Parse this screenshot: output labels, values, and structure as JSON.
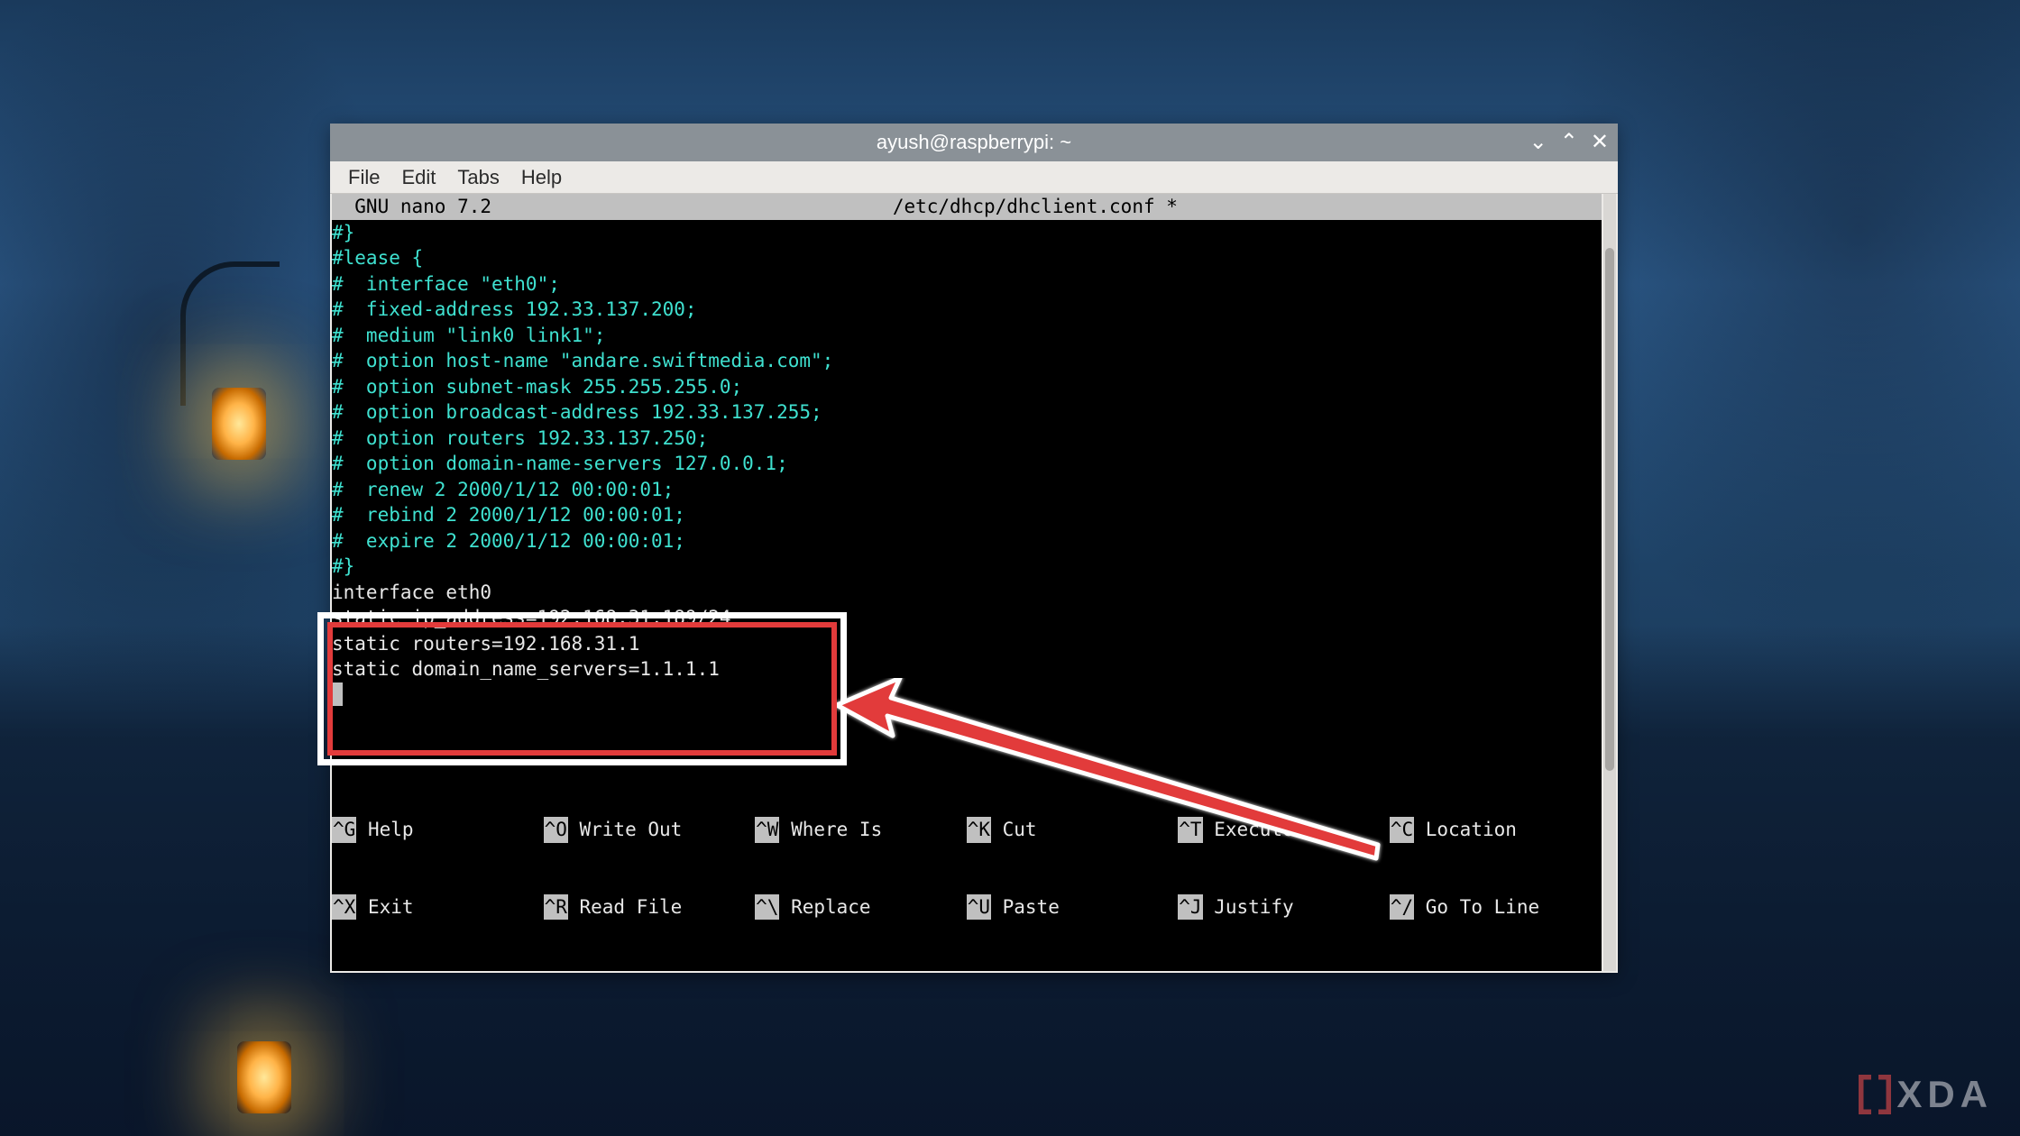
{
  "titlebar": {
    "title": "ayush@raspberrypi: ~"
  },
  "menubar": {
    "file": "File",
    "edit": "Edit",
    "tabs": "Tabs",
    "help": "Help"
  },
  "nano": {
    "app": "GNU nano 7.2",
    "filepath": "/etc/dhcp/dhclient.conf *"
  },
  "editor": {
    "lines_cyan": [
      "#}",
      "",
      "#lease {",
      "#  interface \"eth0\";",
      "#  fixed-address 192.33.137.200;",
      "#  medium \"link0 link1\";",
      "#  option host-name \"andare.swiftmedia.com\";",
      "#  option subnet-mask 255.255.255.0;",
      "#  option broadcast-address 192.33.137.255;",
      "#  option routers 192.33.137.250;",
      "#  option domain-name-servers 127.0.0.1;",
      "#  renew 2 2000/1/12 00:00:01;",
      "#  rebind 2 2000/1/12 00:00:01;",
      "#  expire 2 2000/1/12 00:00:01;",
      "#}"
    ],
    "lines_white": [
      "interface eth0",
      "static ip_address=192.168.31.189/24",
      "static routers=192.168.31.1",
      "static domain_name_servers=1.1.1.1"
    ]
  },
  "shortcuts": {
    "row1": [
      {
        "key": "^G",
        "label": "Help"
      },
      {
        "key": "^O",
        "label": "Write Out"
      },
      {
        "key": "^W",
        "label": "Where Is"
      },
      {
        "key": "^K",
        "label": "Cut"
      },
      {
        "key": "^T",
        "label": "Execute"
      },
      {
        "key": "^C",
        "label": "Location"
      }
    ],
    "row2": [
      {
        "key": "^X",
        "label": "Exit"
      },
      {
        "key": "^R",
        "label": "Read File"
      },
      {
        "key": "^\\",
        "label": "Replace"
      },
      {
        "key": "^U",
        "label": "Paste"
      },
      {
        "key": "^J",
        "label": "Justify"
      },
      {
        "key": "^/",
        "label": "Go To Line"
      }
    ]
  },
  "logo": {
    "text": "XDA"
  }
}
